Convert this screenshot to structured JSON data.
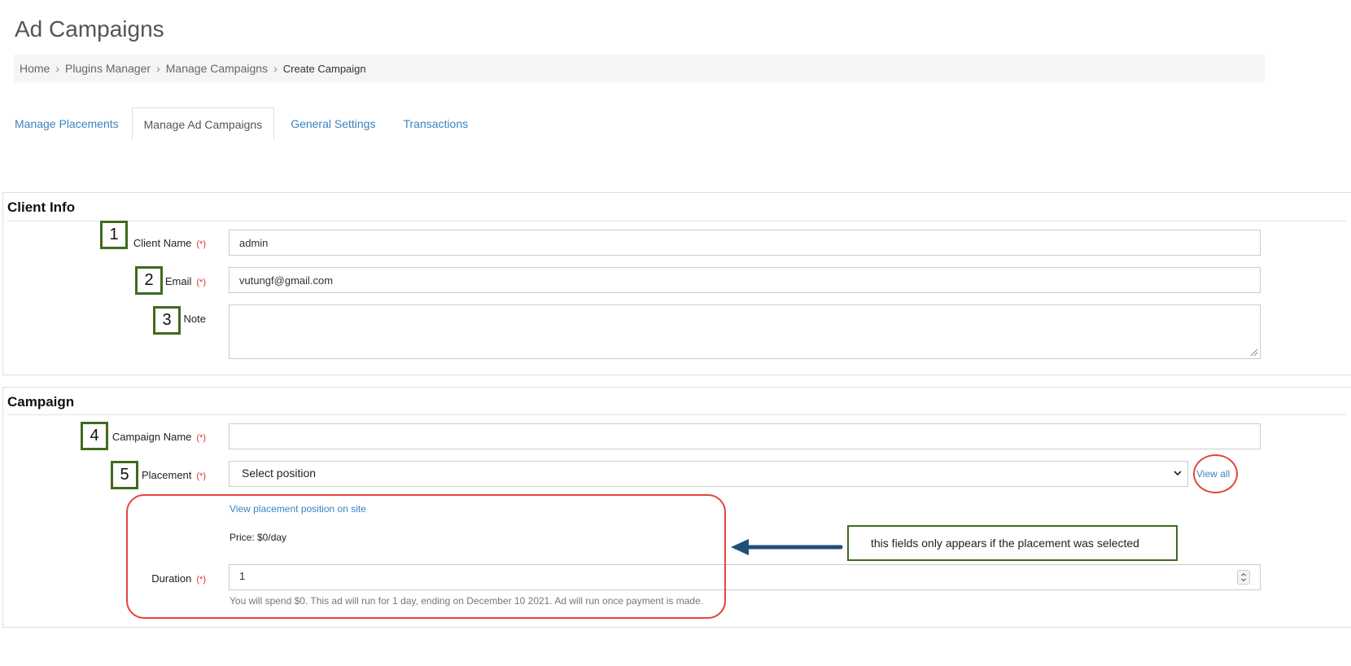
{
  "page": {
    "title": "Ad Campaigns"
  },
  "breadcrumb": {
    "items": [
      "Home",
      "Plugins Manager",
      "Manage Campaigns"
    ],
    "current": "Create Campaign",
    "separator": "›"
  },
  "tabs": [
    {
      "label": "Manage Placements",
      "active": false
    },
    {
      "label": "Manage Ad Campaigns",
      "active": true
    },
    {
      "label": "General Settings",
      "active": false
    },
    {
      "label": "Transactions",
      "active": false
    }
  ],
  "client_info": {
    "title": "Client Info",
    "client_name": {
      "label": "Client Name",
      "required": "(*)",
      "value": "admin",
      "marker": "1"
    },
    "email": {
      "label": "Email",
      "required": "(*)",
      "value": "vutungf@gmail.com",
      "marker": "2"
    },
    "note": {
      "label": "Note",
      "value": "",
      "marker": "3"
    }
  },
  "campaign": {
    "title": "Campaign",
    "campaign_name": {
      "label": "Campaign Name",
      "required": "(*)",
      "value": "",
      "marker": "4"
    },
    "placement": {
      "label": "Placement",
      "required": "(*)",
      "selected": "Select position",
      "marker": "5",
      "view_all": "View all"
    },
    "view_position_link": "View placement position on site",
    "price": "Price: $0/day",
    "duration": {
      "label": "Duration",
      "required": "(*)",
      "value": "1"
    },
    "help_text": "You will spend $0. This ad will run for 1 day, ending on December 10 2021. Ad will run once payment is made."
  },
  "annotation": {
    "callout": "this fields only appears if the placement was selected",
    "marker_color": "#3f6b1f",
    "highlight_color": "#e0463f",
    "arrow_color": "#1f4e79"
  }
}
